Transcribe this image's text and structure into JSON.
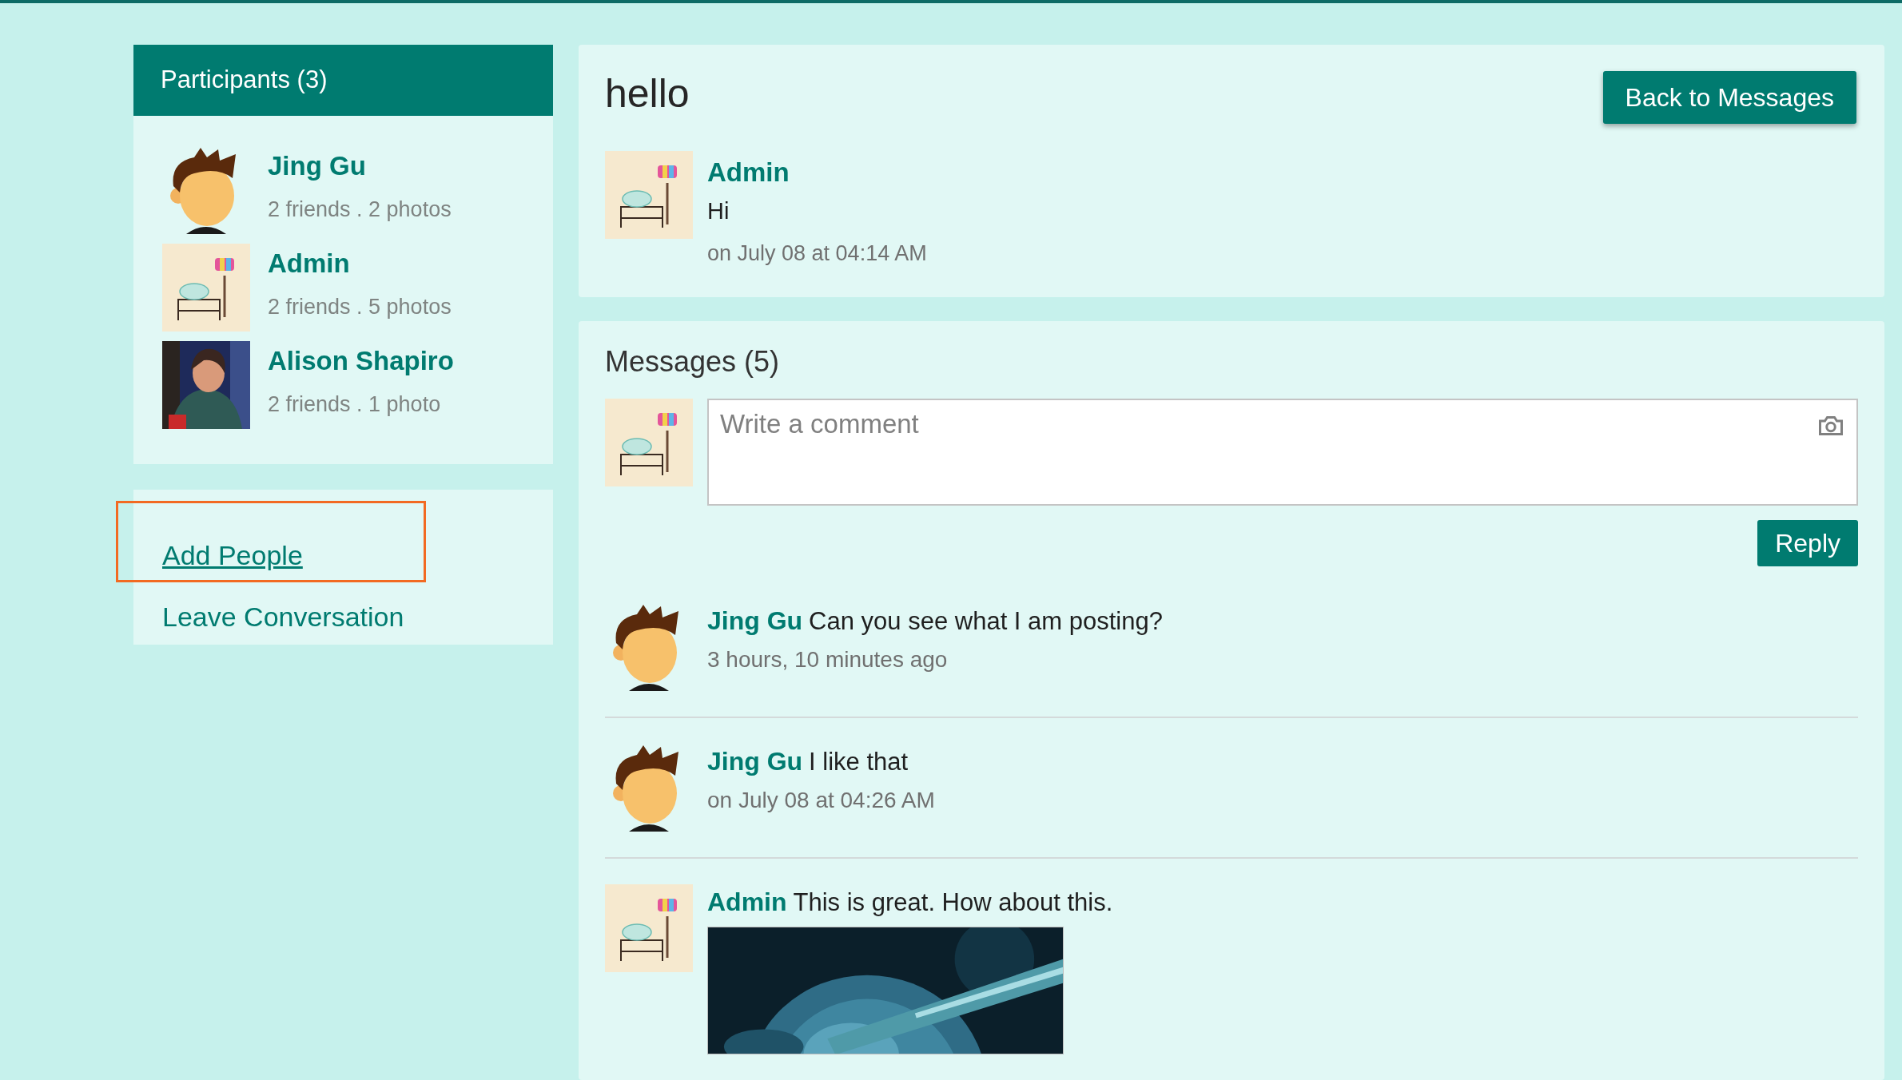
{
  "participants": {
    "title": "Participants (3)",
    "items": [
      {
        "name": "Jing Gu",
        "stats": "2 friends . 2 photos",
        "kind": "cartoon"
      },
      {
        "name": "Admin",
        "stats": "2 friends . 5 photos",
        "kind": "sketch"
      },
      {
        "name": "Alison Shapiro",
        "stats": "2 friends . 1 photo"
      }
    ]
  },
  "actions": [
    {
      "label": "Add People",
      "highlighted": true
    },
    {
      "label": "Leave Conversation",
      "highlighted": false
    }
  ],
  "conversation": {
    "title": "hello",
    "back_button": "Back to Messages",
    "first_message": {
      "author": "Admin",
      "text": "Hi",
      "time": "on July 08 at 04:14 AM",
      "kind": "sketch"
    }
  },
  "messages": {
    "title": "Messages (5)",
    "comment": {
      "placeholder": "Write a comment",
      "kind": "sketch"
    },
    "reply_button": "Reply",
    "items": [
      {
        "author": "Jing Gu",
        "text": "Can you see what I am posting?",
        "time": "3 hours, 10 minutes ago",
        "kind": "cartoon"
      },
      {
        "author": "Jing Gu",
        "text": "I like that",
        "time": "on July 08 at 04:26 AM",
        "kind": "cartoon"
      },
      {
        "author": "Admin",
        "text": "This is great. How about this.",
        "kind": "sketch"
      }
    ]
  }
}
